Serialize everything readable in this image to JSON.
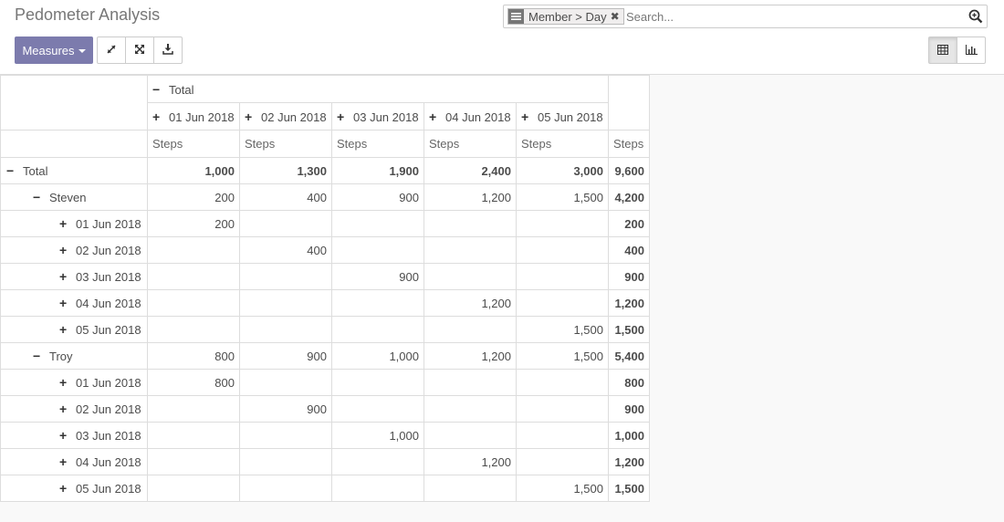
{
  "header": {
    "title": "Pedometer Analysis"
  },
  "search": {
    "facet_value": "Member > Day",
    "facet_icon": "list-icon",
    "placeholder": "Search..."
  },
  "toolbar": {
    "measures_label": "Measures",
    "buttons": [
      "expand-all-icon",
      "flip-axis-icon",
      "download-icon"
    ],
    "views": [
      "pivot-view-icon",
      "graph-view-icon"
    ],
    "active_view": "pivot-view-icon"
  },
  "pivot": {
    "col_group_label": "Total",
    "columns": [
      "01 Jun 2018",
      "02 Jun 2018",
      "03 Jun 2018",
      "04 Jun 2018",
      "05 Jun 2018"
    ],
    "measure": "Steps",
    "rows": [
      {
        "label": "Total",
        "level": 0,
        "sym": "−",
        "values": [
          "1,000",
          "1,300",
          "1,900",
          "2,400",
          "3,000"
        ],
        "total": "9,600",
        "bold": true
      },
      {
        "label": "Steven",
        "level": 1,
        "sym": "−",
        "values": [
          "200",
          "400",
          "900",
          "1,200",
          "1,500"
        ],
        "total": "4,200",
        "bold": false
      },
      {
        "label": "01 Jun 2018",
        "level": 2,
        "sym": "+",
        "values": [
          "200",
          "",
          "",
          "",
          ""
        ],
        "total": "200",
        "bold": false
      },
      {
        "label": "02 Jun 2018",
        "level": 2,
        "sym": "+",
        "values": [
          "",
          "400",
          "",
          "",
          ""
        ],
        "total": "400",
        "bold": false
      },
      {
        "label": "03 Jun 2018",
        "level": 2,
        "sym": "+",
        "values": [
          "",
          "",
          "900",
          "",
          ""
        ],
        "total": "900",
        "bold": false
      },
      {
        "label": "04 Jun 2018",
        "level": 2,
        "sym": "+",
        "values": [
          "",
          "",
          "",
          "1,200",
          ""
        ],
        "total": "1,200",
        "bold": false
      },
      {
        "label": "05 Jun 2018",
        "level": 2,
        "sym": "+",
        "values": [
          "",
          "",
          "",
          "",
          "1,500"
        ],
        "total": "1,500",
        "bold": false
      },
      {
        "label": "Troy",
        "level": 1,
        "sym": "−",
        "values": [
          "800",
          "900",
          "1,000",
          "1,200",
          "1,500"
        ],
        "total": "5,400",
        "bold": false
      },
      {
        "label": "01 Jun 2018",
        "level": 2,
        "sym": "+",
        "values": [
          "800",
          "",
          "",
          "",
          ""
        ],
        "total": "800",
        "bold": false
      },
      {
        "label": "02 Jun 2018",
        "level": 2,
        "sym": "+",
        "values": [
          "",
          "900",
          "",
          "",
          ""
        ],
        "total": "900",
        "bold": false
      },
      {
        "label": "03 Jun 2018",
        "level": 2,
        "sym": "+",
        "values": [
          "",
          "",
          "1,000",
          "",
          ""
        ],
        "total": "1,000",
        "bold": false
      },
      {
        "label": "04 Jun 2018",
        "level": 2,
        "sym": "+",
        "values": [
          "",
          "",
          "",
          "1,200",
          ""
        ],
        "total": "1,200",
        "bold": false
      },
      {
        "label": "05 Jun 2018",
        "level": 2,
        "sym": "+",
        "values": [
          "",
          "",
          "",
          "",
          "1,500"
        ],
        "total": "1,500",
        "bold": false
      }
    ]
  }
}
